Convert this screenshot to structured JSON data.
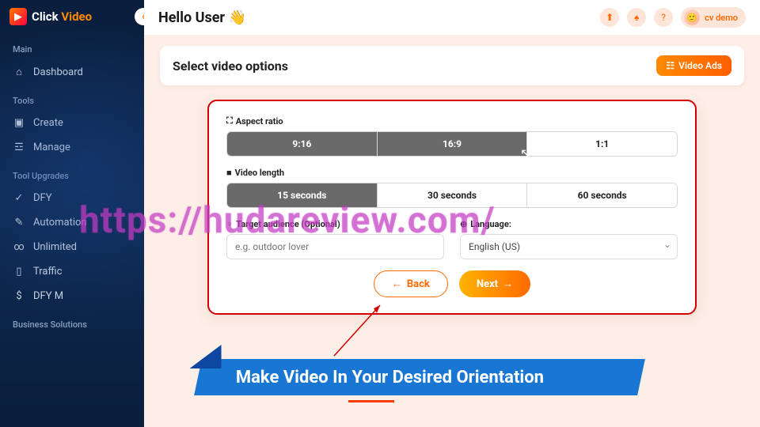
{
  "brand": {
    "name_a": "Click ",
    "name_b": "Video"
  },
  "sidebar": {
    "sections": [
      {
        "label": "Main",
        "items": [
          {
            "icon": "⌂",
            "label": "Dashboard"
          }
        ]
      },
      {
        "label": "Tools",
        "items": [
          {
            "icon": "▣",
            "label": "Create"
          },
          {
            "icon": "☲",
            "label": "Manage"
          }
        ]
      },
      {
        "label": "Tool Upgrades",
        "items": [
          {
            "icon": "✓",
            "label": "DFY"
          },
          {
            "icon": "✎",
            "label": "Automation"
          },
          {
            "icon": "∞",
            "label": "Unlimited"
          },
          {
            "icon": "▯",
            "label": "Traffic"
          },
          {
            "icon": "$",
            "label": "DFY M"
          }
        ]
      },
      {
        "label": "Business Solutions",
        "items": []
      }
    ]
  },
  "header": {
    "greeting": "Hello User 👋",
    "user": "cv demo"
  },
  "page": {
    "title": "Select video options",
    "badge": "Video Ads"
  },
  "options": {
    "aspect": {
      "label": "Aspect ratio",
      "items": [
        "9:16",
        "16:9",
        "1:1"
      ],
      "selected": [
        0,
        1
      ]
    },
    "length": {
      "label": "Video length",
      "items": [
        "15 seconds",
        "30 seconds",
        "60 seconds"
      ],
      "selected": [
        0
      ]
    },
    "audience": {
      "label": "Target audience (Optional)",
      "placeholder": "e.g. outdoor lover"
    },
    "language": {
      "label": "Language:",
      "value": "English (US)"
    }
  },
  "buttons": {
    "back": "Back",
    "next": "Next"
  },
  "callout": "Make Video In Your Desired Orientation",
  "watermark": "https://hudareview.com/"
}
